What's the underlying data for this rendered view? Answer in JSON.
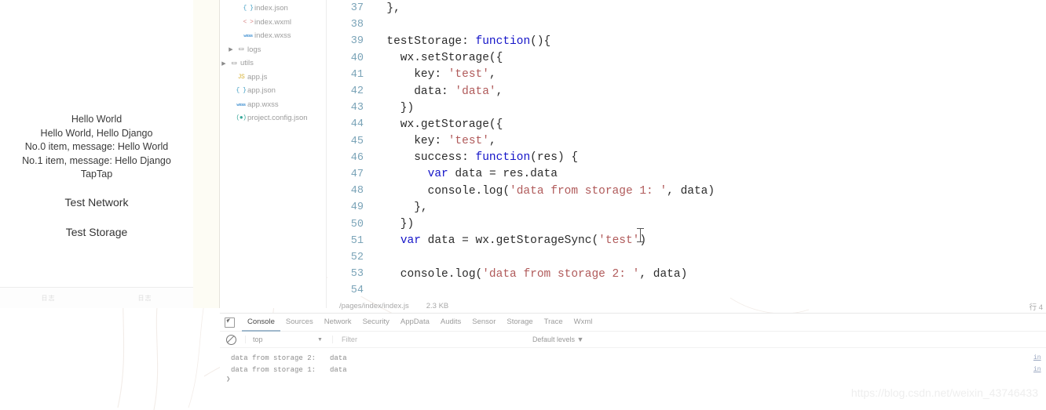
{
  "simulator": {
    "lines": [
      "Hello World",
      "Hello World, Hello Django",
      "No.0 item, message: Hello World",
      "No.1 item, message: Hello Django",
      "TapTap"
    ],
    "buttons": [
      "Test Network",
      "Test Storage"
    ],
    "tabs": [
      "日志",
      "日志"
    ]
  },
  "filetree": {
    "items": [
      {
        "label": "index.json",
        "icon": "json-file-icon",
        "icon_glyph": "{ }",
        "indent": 2,
        "twisty": ""
      },
      {
        "label": "index.wxml",
        "icon": "wxml-file-icon",
        "icon_glyph": "< >",
        "indent": 2,
        "twisty": ""
      },
      {
        "label": "index.wxss",
        "icon": "wxss-file-icon",
        "icon_glyph": "wxss",
        "indent": 2,
        "twisty": ""
      },
      {
        "label": "logs",
        "icon": "folder-icon",
        "icon_glyph": "▭",
        "indent": 1,
        "twisty": "▶"
      },
      {
        "label": "utils",
        "icon": "folder-icon",
        "icon_glyph": "▭",
        "indent": 0,
        "twisty": "▶"
      },
      {
        "label": "app.js",
        "icon": "js-file-icon",
        "icon_glyph": "JS",
        "indent": 1,
        "twisty": ""
      },
      {
        "label": "app.json",
        "icon": "json-file-icon",
        "icon_glyph": "{ }",
        "indent": 1,
        "twisty": ""
      },
      {
        "label": "app.wxss",
        "icon": "wxss-file-icon",
        "icon_glyph": "wxss",
        "indent": 1,
        "twisty": ""
      },
      {
        "label": "project.config.json",
        "icon": "config-file-icon",
        "icon_glyph": "(●)",
        "indent": 1,
        "twisty": ""
      }
    ]
  },
  "editor": {
    "lines": [
      {
        "n": "37",
        "tokens": [
          {
            "t": "  },",
            "c": "pl"
          }
        ]
      },
      {
        "n": "38",
        "tokens": [
          {
            "t": "",
            "c": "pl"
          }
        ]
      },
      {
        "n": "39",
        "tokens": [
          {
            "t": "  testStorage: ",
            "c": "pl"
          },
          {
            "t": "function",
            "c": "kw"
          },
          {
            "t": "(){",
            "c": "pl"
          }
        ]
      },
      {
        "n": "40",
        "tokens": [
          {
            "t": "    wx.setStorage({",
            "c": "pl"
          }
        ]
      },
      {
        "n": "41",
        "tokens": [
          {
            "t": "      key: ",
            "c": "pl"
          },
          {
            "t": "'test'",
            "c": "str"
          },
          {
            "t": ",",
            "c": "pl"
          }
        ]
      },
      {
        "n": "42",
        "tokens": [
          {
            "t": "      data: ",
            "c": "pl"
          },
          {
            "t": "'data'",
            "c": "str"
          },
          {
            "t": ",",
            "c": "pl"
          }
        ]
      },
      {
        "n": "43",
        "tokens": [
          {
            "t": "    })",
            "c": "pl"
          }
        ]
      },
      {
        "n": "44",
        "tokens": [
          {
            "t": "    wx.getStorage({",
            "c": "pl"
          }
        ]
      },
      {
        "n": "45",
        "tokens": [
          {
            "t": "      key: ",
            "c": "pl"
          },
          {
            "t": "'test'",
            "c": "str"
          },
          {
            "t": ",",
            "c": "pl"
          }
        ]
      },
      {
        "n": "46",
        "tokens": [
          {
            "t": "      success: ",
            "c": "pl"
          },
          {
            "t": "function",
            "c": "kw"
          },
          {
            "t": "(res) {",
            "c": "pl"
          }
        ]
      },
      {
        "n": "47",
        "tokens": [
          {
            "t": "        ",
            "c": "pl"
          },
          {
            "t": "var",
            "c": "kw"
          },
          {
            "t": " data = res.data",
            "c": "pl"
          }
        ]
      },
      {
        "n": "48",
        "tokens": [
          {
            "t": "        console.log(",
            "c": "pl"
          },
          {
            "t": "'data from storage 1: '",
            "c": "str"
          },
          {
            "t": ", data)",
            "c": "pl"
          }
        ]
      },
      {
        "n": "49",
        "tokens": [
          {
            "t": "      },",
            "c": "pl"
          }
        ]
      },
      {
        "n": "50",
        "tokens": [
          {
            "t": "    })",
            "c": "pl"
          }
        ]
      },
      {
        "n": "51",
        "tokens": [
          {
            "t": "    ",
            "c": "pl"
          },
          {
            "t": "var",
            "c": "kw"
          },
          {
            "t": " data = wx.getStorageSync(",
            "c": "pl"
          },
          {
            "t": "'test'",
            "c": "str"
          },
          {
            "t": ")",
            "c": "pl"
          }
        ]
      },
      {
        "n": "52",
        "tokens": [
          {
            "t": "",
            "c": "pl"
          }
        ]
      },
      {
        "n": "53",
        "tokens": [
          {
            "t": "    console.log(",
            "c": "pl"
          },
          {
            "t": "'data from storage 2: '",
            "c": "str"
          },
          {
            "t": ", data)",
            "c": "pl"
          }
        ]
      },
      {
        "n": "54",
        "tokens": [
          {
            "t": "",
            "c": "pl"
          }
        ]
      }
    ]
  },
  "statusbar": {
    "path": "/pages/index/index.js",
    "size": "2.3 KB",
    "cursor": "行 4"
  },
  "devtools": {
    "tabs": [
      {
        "label": "Console",
        "active": true
      },
      {
        "label": "Sources",
        "active": false
      },
      {
        "label": "Network",
        "active": false
      },
      {
        "label": "Security",
        "active": false
      },
      {
        "label": "AppData",
        "active": false
      },
      {
        "label": "Audits",
        "active": false
      },
      {
        "label": "Sensor",
        "active": false
      },
      {
        "label": "Storage",
        "active": false
      },
      {
        "label": "Trace",
        "active": false
      },
      {
        "label": "Wxml",
        "active": false
      }
    ],
    "context": "top",
    "filter_placeholder": "Filter",
    "levels": "Default levels ▼",
    "logs": [
      {
        "message": "data from storage 2:",
        "value": "data",
        "source": "in"
      },
      {
        "message": "data from storage 1:",
        "value": "data",
        "source": "in"
      }
    ],
    "prompt": "❯"
  },
  "watermark": "https://blog.csdn.net/weixin_43746433"
}
